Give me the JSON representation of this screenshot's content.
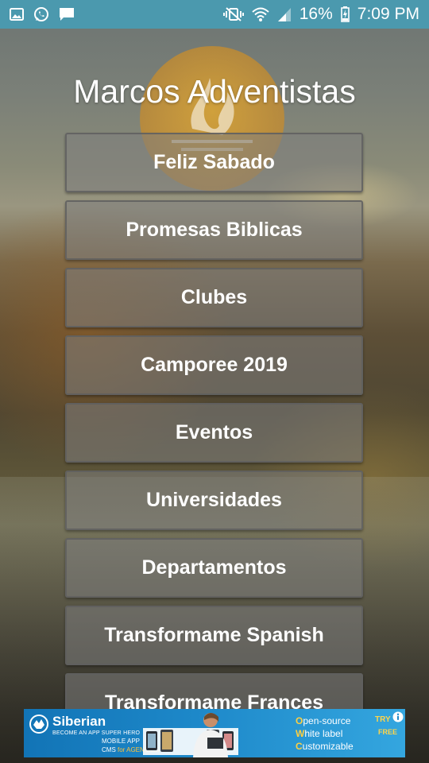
{
  "status_bar": {
    "battery": "16%",
    "time": "7:09 PM",
    "icons": [
      "gallery-icon",
      "whatsapp-icon",
      "message-icon",
      "vibrate-mute-icon",
      "wifi-icon",
      "signal-icon",
      "battery-charging-icon"
    ]
  },
  "app": {
    "title": "Marcos Adventistas"
  },
  "menu": {
    "items": [
      "Feliz Sabado",
      "Promesas Biblicas",
      "Clubes",
      "Camporee 2019",
      "Eventos",
      "Universidades",
      "Departamentos",
      "Transformame Spanish",
      "Transformame Frances"
    ]
  },
  "ad": {
    "brand": "Siberian",
    "tagline": "BECOME AN APP SUPER HERO",
    "sub_line1": "MOBILE APP",
    "sub_line2_a": "CMS ",
    "sub_line2_b": "for AGENCIES",
    "copy_line1_a": "O",
    "copy_line1_b": "pen-source",
    "copy_line2_a": "W",
    "copy_line2_b": "hite label",
    "copy_line3_a": "C",
    "copy_line3_b": "ustomizable",
    "try": "TRY",
    "free": "FREE"
  },
  "colors": {
    "status_bar": "#4b99ae",
    "ad_background": "#1d88c9",
    "logo": "#e3a22b"
  }
}
